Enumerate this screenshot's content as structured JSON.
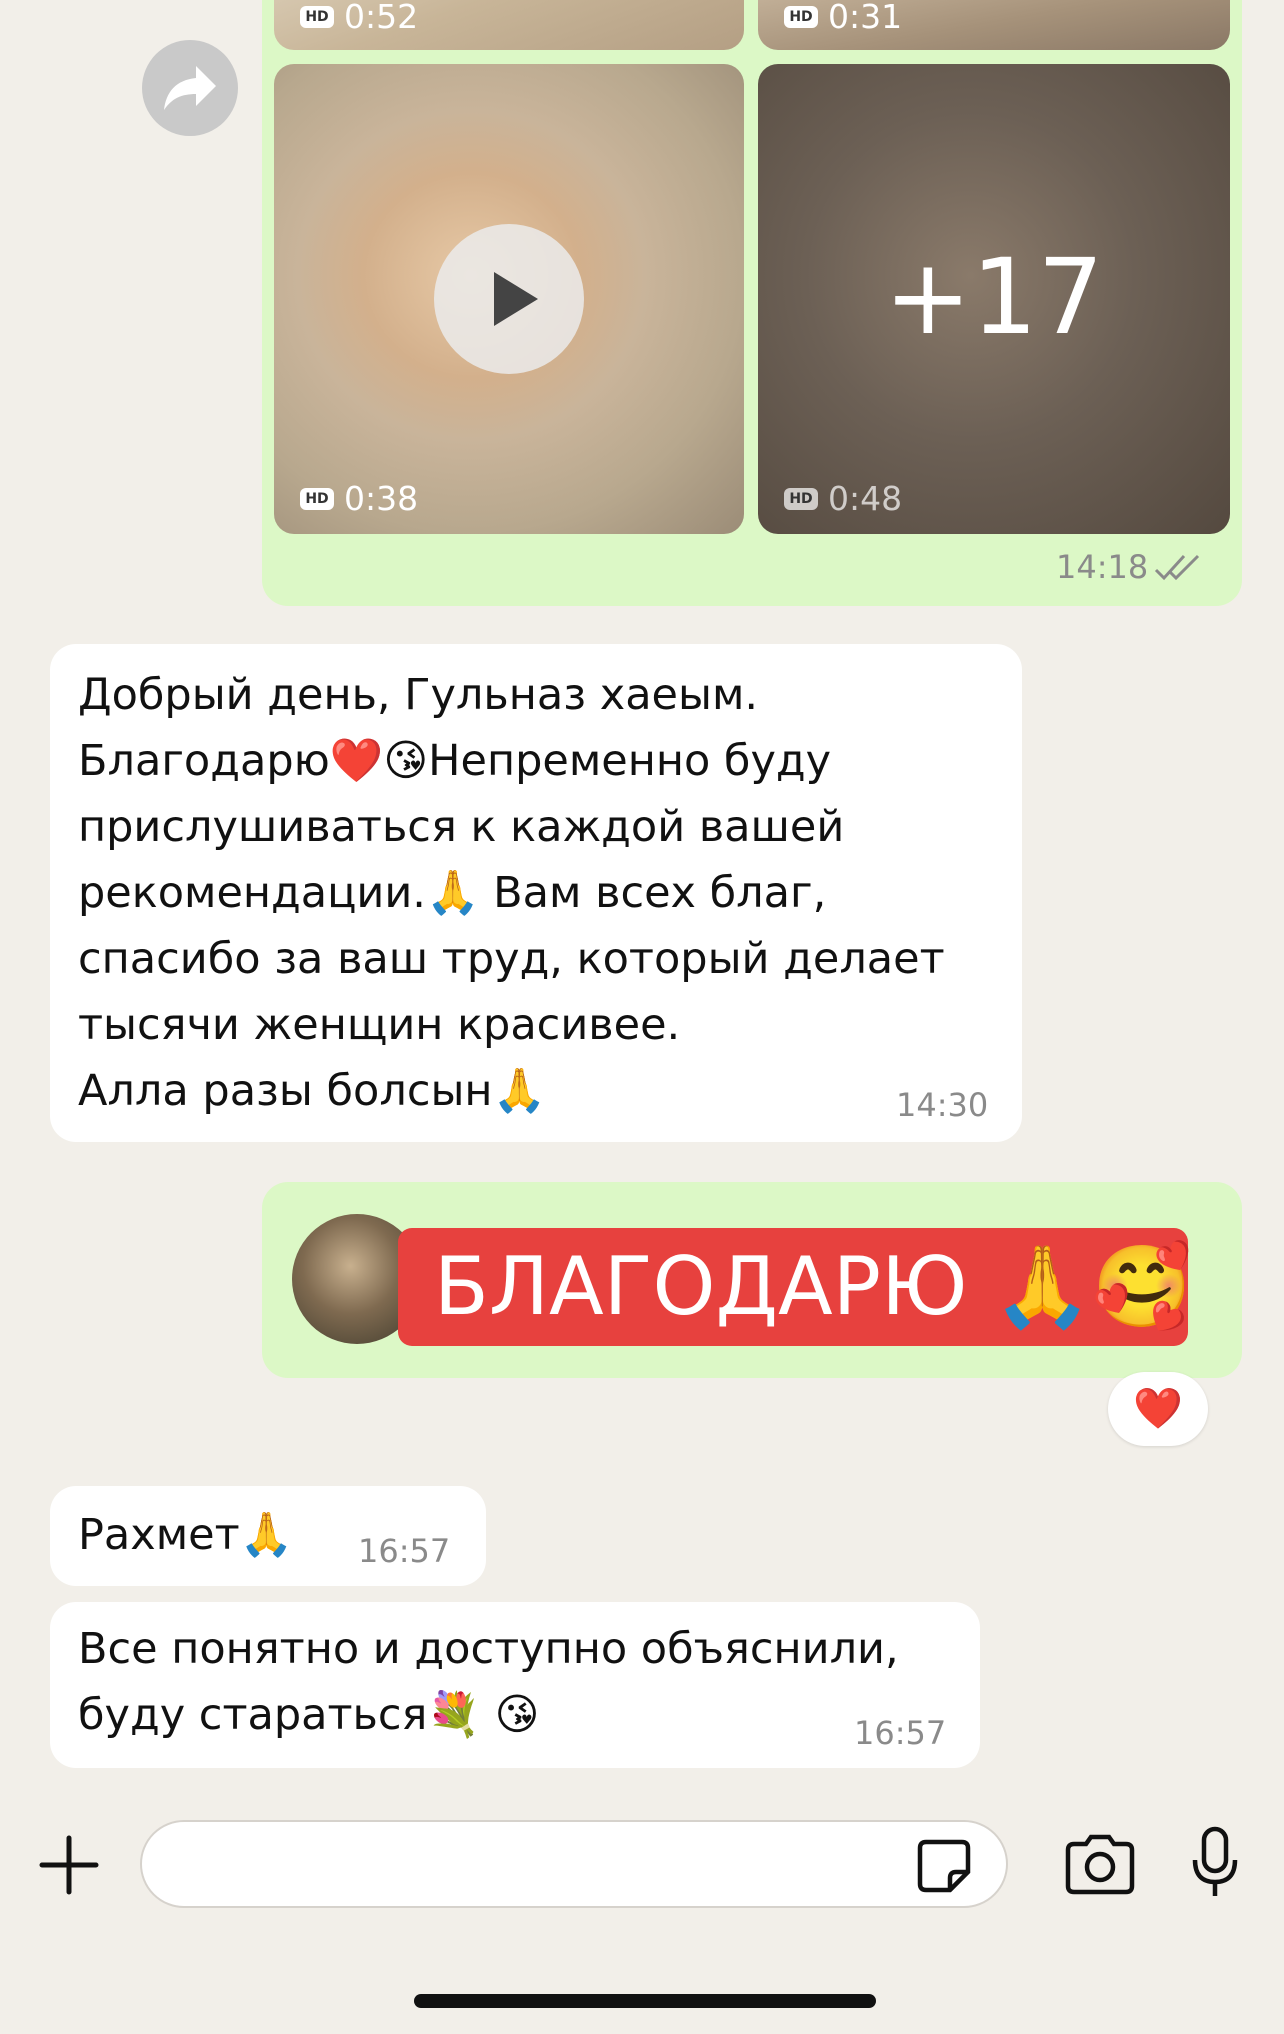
{
  "media_group": {
    "videos": [
      {
        "duration": "0:52",
        "hd": "HD"
      },
      {
        "duration": "0:31",
        "hd": "HD"
      },
      {
        "duration": "0:38",
        "hd": "HD"
      },
      {
        "duration": "0:48",
        "hd": "HD"
      }
    ],
    "more_count": "+17",
    "time": "14:18"
  },
  "messages": [
    {
      "text": "Добрый день, Гульназ хаеым.\nБлагодарю❤️😘Непременно буду\nприслушиваться к каждой вашей\nрекомендации.🙏 Вам всех благ,\nспасибо за ваш труд, который делает\nтысячи женщин красивее.\nАлла разы болсын🙏",
      "time": "14:30"
    },
    {
      "text": "Рахмет🙏",
      "time": "16:57"
    },
    {
      "text": "Все понятно и доступно объяснили,\nбуду стараться💐 😘",
      "time": "16:57"
    }
  ],
  "sticker_message": {
    "sticker_text": "БЛАГОДАРЮ 🙏🥰",
    "reaction": "❤️"
  },
  "icons": {
    "forward": "forward-arrow-icon",
    "play": "play-icon",
    "read_receipt": "double-check-icon",
    "attach": "plus-icon",
    "sticker": "sticker-icon",
    "camera": "camera-icon",
    "mic": "microphone-icon"
  },
  "colors": {
    "outgoing_bubble": "#dcf8c6",
    "incoming_bubble": "#ffffff",
    "chat_background": "#f2efe9",
    "sticker_red": "#e7413e"
  }
}
